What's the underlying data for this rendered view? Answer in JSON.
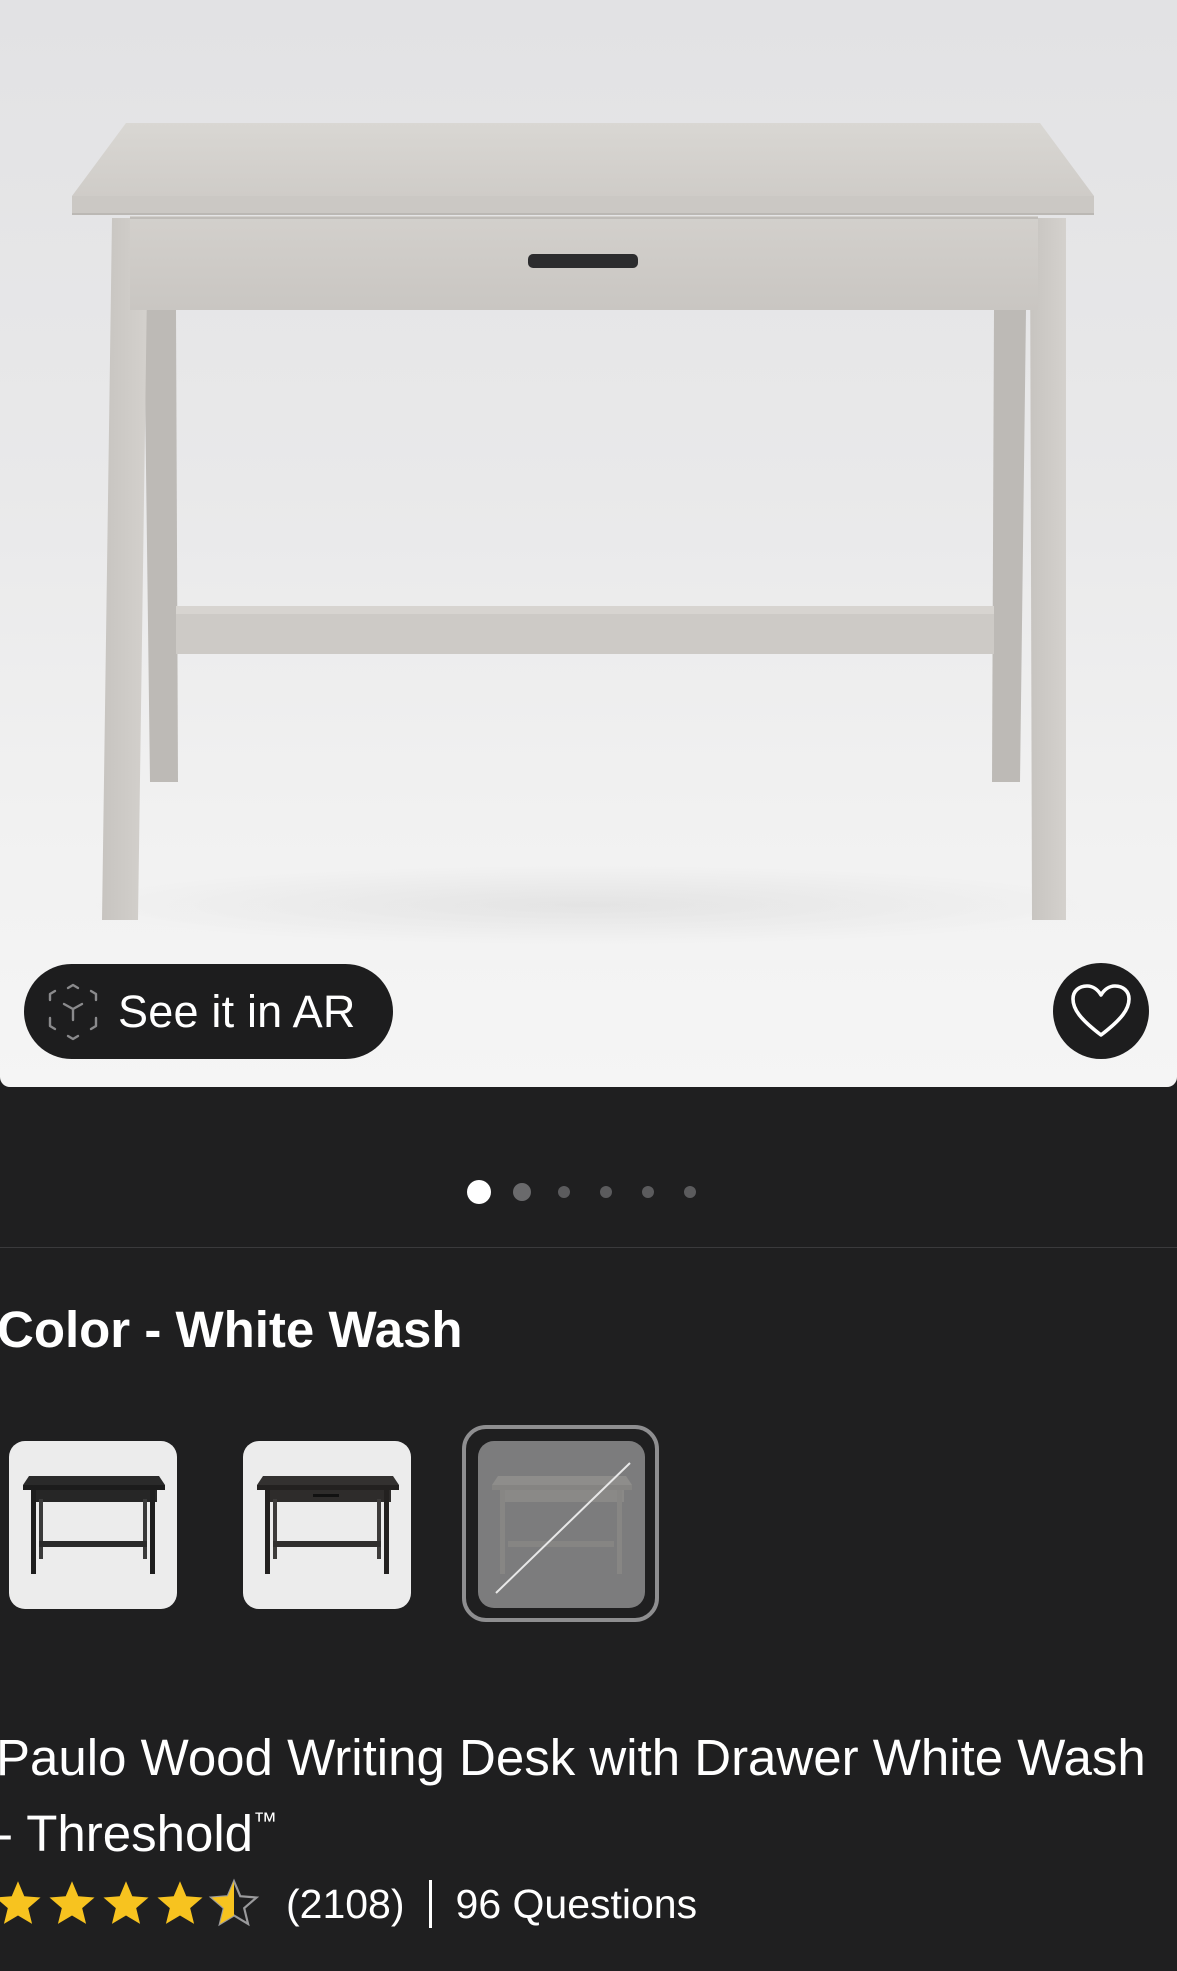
{
  "hero": {
    "ar_button_label": "See it in AR",
    "ar_icon": "cube-ar-icon",
    "favorite_icon": "heart-outline-icon",
    "carousel": {
      "total": 6,
      "active_index": 0
    }
  },
  "color_selector": {
    "label": "Color - White Wash",
    "options": [
      {
        "name": "black-desk-swatch",
        "selected": false,
        "available": true
      },
      {
        "name": "espresso-desk-swatch",
        "selected": false,
        "available": true
      },
      {
        "name": "white-wash-desk-swatch",
        "selected": true,
        "available": false
      }
    ]
  },
  "product": {
    "title": "Paulo Wood Writing Desk with Drawer White Wash - Threshold",
    "trademark": "™",
    "rating": 4.5,
    "rating_max": 5,
    "review_count_label": "(2108)",
    "questions_label": "96 Questions"
  },
  "colors": {
    "background": "#1f1f20",
    "star": "#f7c31f",
    "pill": "#1d1d1e"
  }
}
